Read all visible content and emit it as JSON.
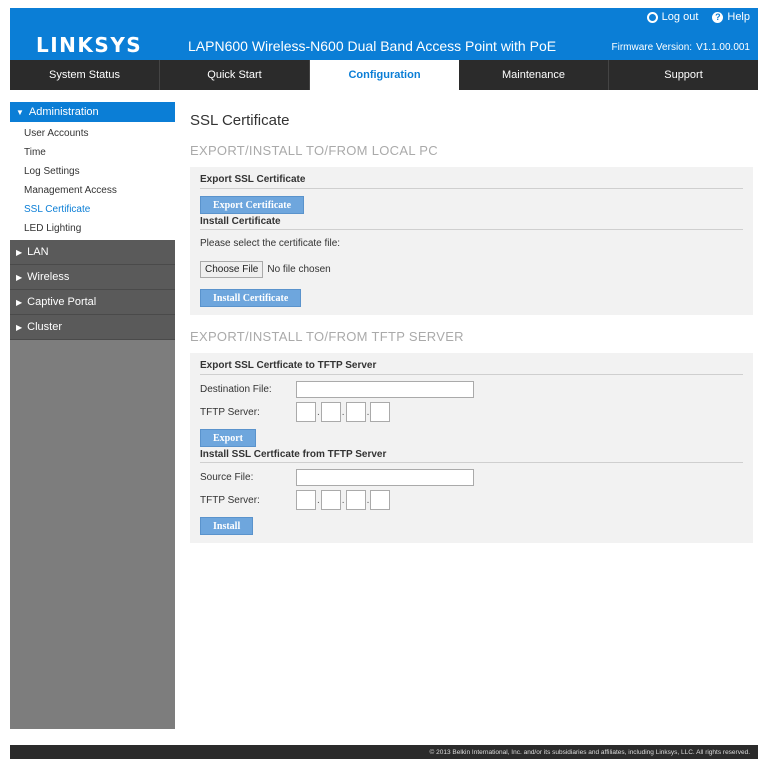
{
  "header": {
    "logo": "LINKSYS",
    "product_title": "LAPN600 Wireless-N600 Dual Band Access Point with PoE",
    "logout_label": "Log out",
    "help_label": "Help",
    "firmware_label": "Firmware Version:",
    "firmware_version": "V1.1.00.001"
  },
  "nav": {
    "tabs": [
      "System Status",
      "Quick Start",
      "Configuration",
      "Maintenance",
      "Support"
    ],
    "active": "Configuration"
  },
  "sidebar": {
    "administration": {
      "label": "Administration",
      "items": [
        "User Accounts",
        "Time",
        "Log Settings",
        "Management Access",
        "SSL Certificate",
        "LED Lighting"
      ],
      "active": "SSL Certificate"
    },
    "collapsed": [
      "LAN",
      "Wireless",
      "Captive Portal",
      "Cluster"
    ]
  },
  "main": {
    "page_title": "SSL Certificate",
    "local": {
      "section_title": "EXPORT/INSTALL TO/FROM LOCAL PC",
      "export_heading": "Export SSL Certificate",
      "export_button": "Export Certificate",
      "install_heading": "Install Certificate",
      "select_prompt": "Please select the certificate file:",
      "choose_file": "Choose File",
      "no_file": "No file chosen",
      "install_button": "Install Certificate"
    },
    "tftp": {
      "section_title": "EXPORT/INSTALL TO/FROM TFTP SERVER",
      "export_heading": "Export SSL Certficate to TFTP Server",
      "destination_label": "Destination File:",
      "destination_value": "",
      "tftp_label": "TFTP Server:",
      "export_button": "Export",
      "install_heading": "Install SSL Certficate from TFTP Server",
      "source_label": "Source File:",
      "source_value": "",
      "install_button": "Install"
    }
  },
  "footer": {
    "copyright": "© 2013 Belkin International, Inc. and/or its subsidiaries and affiliates, including Linksys, LLC. All rights reserved."
  },
  "colors": {
    "brand_blue": "#0b7ed6",
    "nav_dark": "#2b2b2b",
    "button_blue": "#6ea6dd",
    "sidebar_gray": "#7d7d7d"
  }
}
